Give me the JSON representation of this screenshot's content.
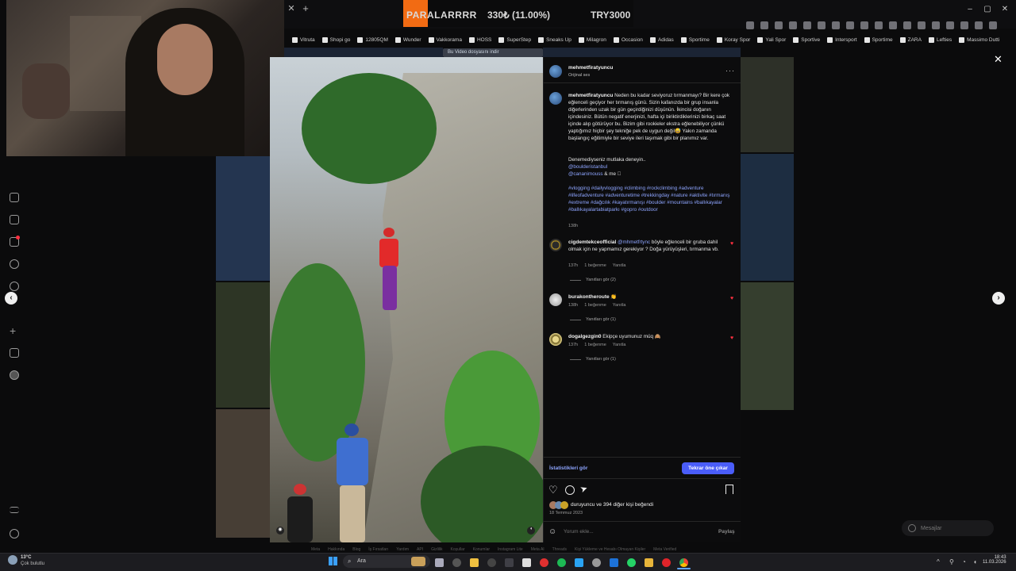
{
  "ticker": {
    "label": "PARALARRRR",
    "pct": "330₺ (11.00%)",
    "target": "TRY3000",
    "accent": "#f26b13"
  },
  "bookmarks": [
    "Vitruta",
    "Shopi go",
    "12805QM",
    "Wunder",
    "Vakkorama",
    "HOSS",
    "SuperStep",
    "Sneaks Up",
    "Milagron",
    "Occasion",
    "Adidas",
    "Sportime",
    "Koray Spor",
    "Yali Spor",
    "Sportive",
    "Intersport",
    "Sportime",
    "ZARA",
    "Lefties",
    "Massimo Dutti"
  ],
  "video_banner": "Bu Video dosyasını indir",
  "post": {
    "author": "mehmetfiratyuncu",
    "audio": "Orijinal ses",
    "caption_user": "mehmetfiratyuncu",
    "caption_text": "Neden bu kadar seviyoruz tırmanmayı? Bir kere çok eğlenceli geçiyor her tırmanış günü. Sizin kafanızda bir grup insanla diğerlerinden uzak bir gün geçirdiğinizi düşünün. İkincisi doğanın içindesiniz. Bütün negatif enerjinizi, hafta içi biriktirdiklerinizi birkaç saat içinde alıp götürüyor bu. Bizim gibi rookieler ekstra eğlenebiliyor çünkü yaptığımız hiçbir şey tekniğe pek de uygun değil😅 Yakın zamanda başlangıç eğitimiyle bir seviye ileri taşımak gibi bir planımız var.",
    "try_line": "Denemediyseniz mutlaka deneyin..",
    "tag1": "@boulderistanbul",
    "tag2": "@cananimouss",
    "tag2_suffix": "& me 🏽",
    "hashtags": "#vlogging #dailyvlogging #climbing #rockclimbing #adventure #lifeofadventure #adventuretime #trekkingday #nature #aktivite #tırmanış #extreme #dağcılık #kayatırmanışı #boulder #mountains #ballıkayalar #ballıkayalartabiatparkı #gopro #outdoor",
    "caption_time": "138h",
    "stats_link": "İstatistikleri gör",
    "boost_button": "Tekrar öne çıkar",
    "likes_text": "duruyuncu ve 394 diğer kişi beğendi",
    "date": "18 Temmuz 2023",
    "comment_placeholder": "Yorum ekle...",
    "share": "Paylaş"
  },
  "comments": [
    {
      "user": "cigdemtekceofficial",
      "mention": "@mhmetfrtync",
      "text": "böyle eğlenceli bir gruba dahil olmak için ne yapmamız gerekiyor ? Doğa yürüyüşleri, tırmanma vb.",
      "time": "137h",
      "likes": "1 beğenme",
      "reply": "Yanıtla",
      "view": "Yanıtları gör (2)"
    },
    {
      "user": "burakontheroute",
      "mention": "",
      "text": "👏",
      "time": "138h",
      "likes": "1 beğenme",
      "reply": "Yanıtla",
      "view": "Yanıtları gör (1)"
    },
    {
      "user": "dogalgezgin0",
      "mention": "",
      "text": "Ekipçe uyumunuz müq 🙈",
      "time": "137h",
      "likes": "1 beğenme",
      "reply": "Yanıtla",
      "view": "Yanıtları gör (1)"
    }
  ],
  "messages": "Mesajlar",
  "taskbar": {
    "weather_temp": "13°C",
    "weather_text": "Çok bulutlu",
    "search": "Ara",
    "time": "18:43",
    "date": "11.03.2026"
  },
  "footer": [
    "Meta",
    "Hakkında",
    "Blog",
    "İş Fırsatları",
    "Yardım",
    "API",
    "Gizlilik",
    "Koşullar",
    "Konumlar",
    "Instagram Lite",
    "Meta AI",
    "Threads",
    "Kişi Yükleme ve Hesabı Olmayan Kişiler",
    "Meta Verified"
  ]
}
